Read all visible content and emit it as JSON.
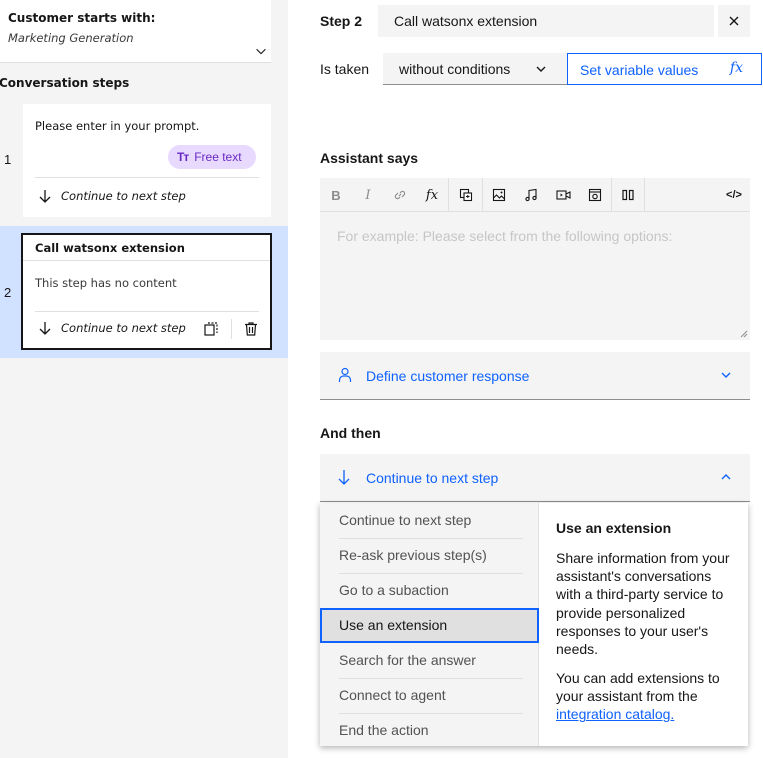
{
  "left_panel": {
    "customer_starts_title": "Customer starts with:",
    "customer_starts_value": "Marketing Generation",
    "conversation_steps_heading": "Conversation steps",
    "steps": [
      {
        "number": "1",
        "prompt": "Please enter in your prompt.",
        "chip_label": "Free text",
        "chip_icon": "Tт",
        "continue_label": "Continue to next step"
      },
      {
        "number": "2",
        "title": "Call watsonx extension",
        "content": "This step has no content",
        "continue_label": "Continue to next step"
      }
    ]
  },
  "editor": {
    "step_label": "Step 2",
    "step_title": "Call watsonx extension",
    "is_taken_label": "Is taken",
    "condition_value": "without conditions",
    "set_variable_label": "Set variable values",
    "fx_label": "fx",
    "assistant_says_label": "Assistant says",
    "toolbar": {
      "bold": "B",
      "italic": "I",
      "fx": "fx",
      "code": "</>"
    },
    "assistant_placeholder": "For example: Please select from the following options:",
    "define_customer_response": "Define customer response",
    "and_then_label": "And then",
    "and_then_value": "Continue to next step"
  },
  "menu": {
    "items": [
      "Continue to next step",
      "Re-ask previous step(s)",
      "Go to a subaction",
      "Use an extension",
      "Search for the answer",
      "Connect to agent",
      "End the action"
    ],
    "selected_index": 3,
    "description": {
      "title": "Use an extension",
      "p1": "Share information from your assistant's conversations with a third-party service to provide personalized responses to your user's needs.",
      "p2_prefix": "You can add extensions to your assistant from the ",
      "p2_link": "integration catalog."
    }
  },
  "colors": {
    "accent": "#0f62fe",
    "selected_step_bg": "#d0e2ff",
    "chip_bg": "#e8daff",
    "chip_text": "#6929c4"
  }
}
